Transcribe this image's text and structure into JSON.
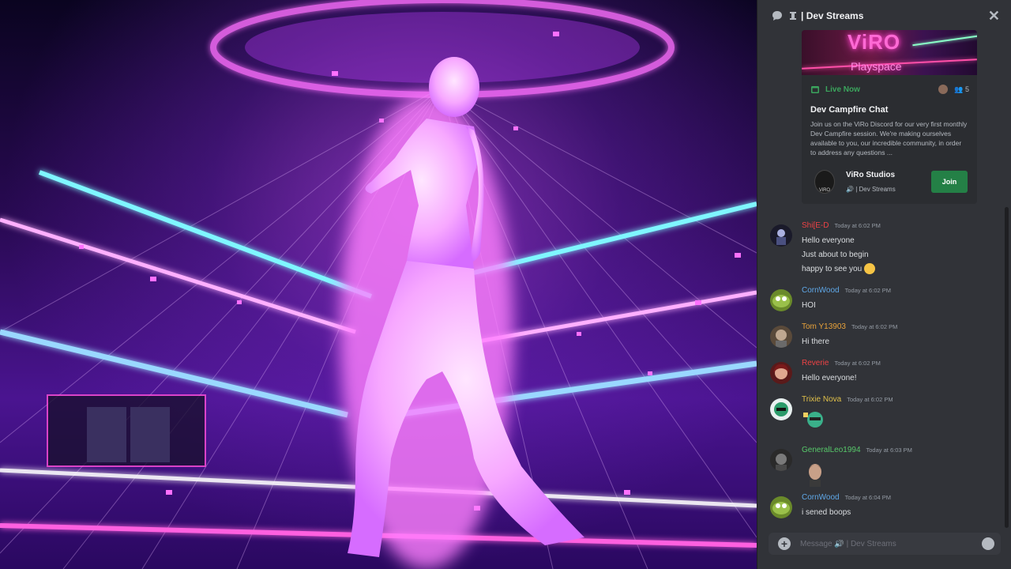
{
  "header": {
    "title": "| Dev Streams"
  },
  "event": {
    "banner_text": "ViRO",
    "banner_sub": "Playspace",
    "status": "Live Now",
    "interested_count": "5",
    "title": "Dev Campfire Chat",
    "description": "Join us on the ViRo Discord for our very first monthly Dev Campfire session. We're making ourselves available to you, our incredible community, in order to address any questions ...",
    "host_name": "ViRo Studios",
    "host_logo_text": "ViRO",
    "channel": "| Dev Streams",
    "join_label": "Join"
  },
  "messages": [
    {
      "author": "Shi[E-D",
      "author_color": "#ed4245",
      "time": "Today at 6:02 PM",
      "lines": [
        "Hello everyone",
        "Just about to begin",
        "happy to see you"
      ],
      "avatar_color": "#3a3a4a"
    },
    {
      "author": "CornWood",
      "author_color": "#5fa8e8",
      "time": "Today at 6:02 PM",
      "lines": [
        "HOI"
      ],
      "avatar_color": "#7a9a3a"
    },
    {
      "author": "Tom Y13903",
      "author_color": "#e8a23a",
      "time": "Today at 6:02 PM",
      "lines": [
        "Hi there"
      ],
      "avatar_color": "#6a5a4a"
    },
    {
      "author": "Reverie",
      "author_color": "#ed4245",
      "time": "Today at 6:02 PM",
      "lines": [
        "Hello everyone!"
      ],
      "avatar_color": "#8a3a3a"
    },
    {
      "author": "Trixie Nova",
      "author_color": "#e0c04a",
      "time": "Today at 6:02 PM",
      "lines": [],
      "avatar_color": "#3a8a6a"
    },
    {
      "author": "GeneralLeo1994",
      "author_color": "#57c86a",
      "time": "Today at 6:03 PM",
      "lines": [],
      "avatar_color": "#3a3a3a"
    },
    {
      "author": "CornWood",
      "author_color": "#5fa8e8",
      "time": "Today at 6:04 PM",
      "lines": [
        "i sened boops"
      ],
      "avatar_color": "#7a9a3a"
    }
  ],
  "composer": {
    "placeholder": "Message 🔊 | Dev Streams"
  },
  "colors": {
    "panel_bg": "#313338",
    "join_green": "#248046",
    "live_green": "#3ba55d"
  }
}
